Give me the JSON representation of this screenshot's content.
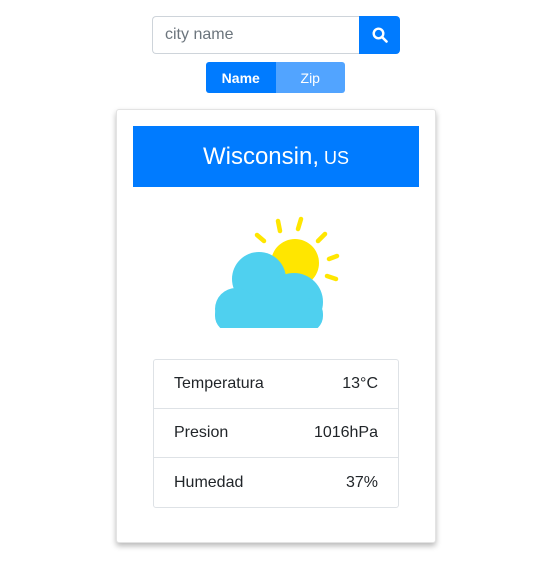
{
  "search": {
    "placeholder": "city name",
    "value": "",
    "button_icon": "search-icon"
  },
  "toggle": {
    "options": [
      {
        "label": "Name",
        "active": true
      },
      {
        "label": "Zip",
        "active": false
      }
    ]
  },
  "card": {
    "city": "Wisconsin,",
    "country": "US",
    "icon": "partly-cloudy-icon",
    "rows": [
      {
        "label": "Temperatura",
        "value": "13°C"
      },
      {
        "label": "Presion",
        "value": "1016hPa"
      },
      {
        "label": "Humedad",
        "value": "37%"
      }
    ]
  },
  "colors": {
    "primary": "#007bff",
    "primary_light": "#52a4ff",
    "sun": "#ffe600",
    "cloud": "#4fd0ef"
  }
}
